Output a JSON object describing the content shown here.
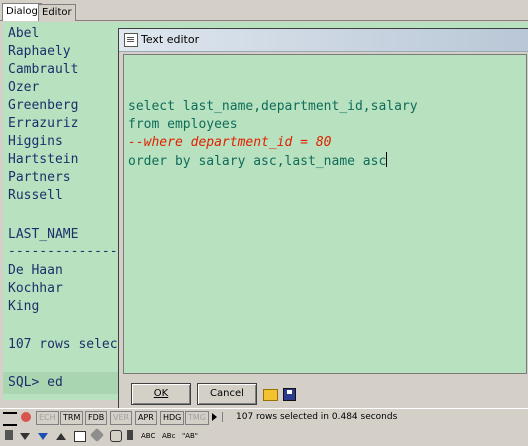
{
  "tabs": [
    "Dialog",
    "Editor"
  ],
  "console": {
    "names": [
      "Abel",
      "Raphaely",
      "Cambrault",
      "Ozer",
      "Greenberg",
      "Errazuriz",
      "Higgins",
      "Hartstein",
      "Partners",
      "Russell"
    ],
    "column_header": "LAST_NAME",
    "separator": "------------------",
    "names2": [
      "De Haan",
      "Kochhar",
      "King"
    ],
    "rows_msg": "107 rows selec",
    "prompt": "SQL> ed"
  },
  "dialog": {
    "title": "Text editor",
    "ok_label": "OK",
    "cancel_label": "Cancel",
    "lines": [
      {
        "text": "select last_name,department_id,salary",
        "kind": "sql"
      },
      {
        "text": "from employees",
        "kind": "sql"
      },
      {
        "text": "--where department_id = 80",
        "kind": "comment"
      },
      {
        "text": "order by salary asc,last_name asc",
        "kind": "sql"
      }
    ]
  },
  "statusbar": {
    "items": [
      "ECH",
      "TRM",
      "FDB",
      "VER",
      "APR",
      "HDG",
      "TMG"
    ],
    "status_text": "107 rows selected in 0.484 seconds"
  },
  "toolbar": {
    "abc": "ABC",
    "abc2": "ABc",
    "quoted": "\"AB\""
  }
}
